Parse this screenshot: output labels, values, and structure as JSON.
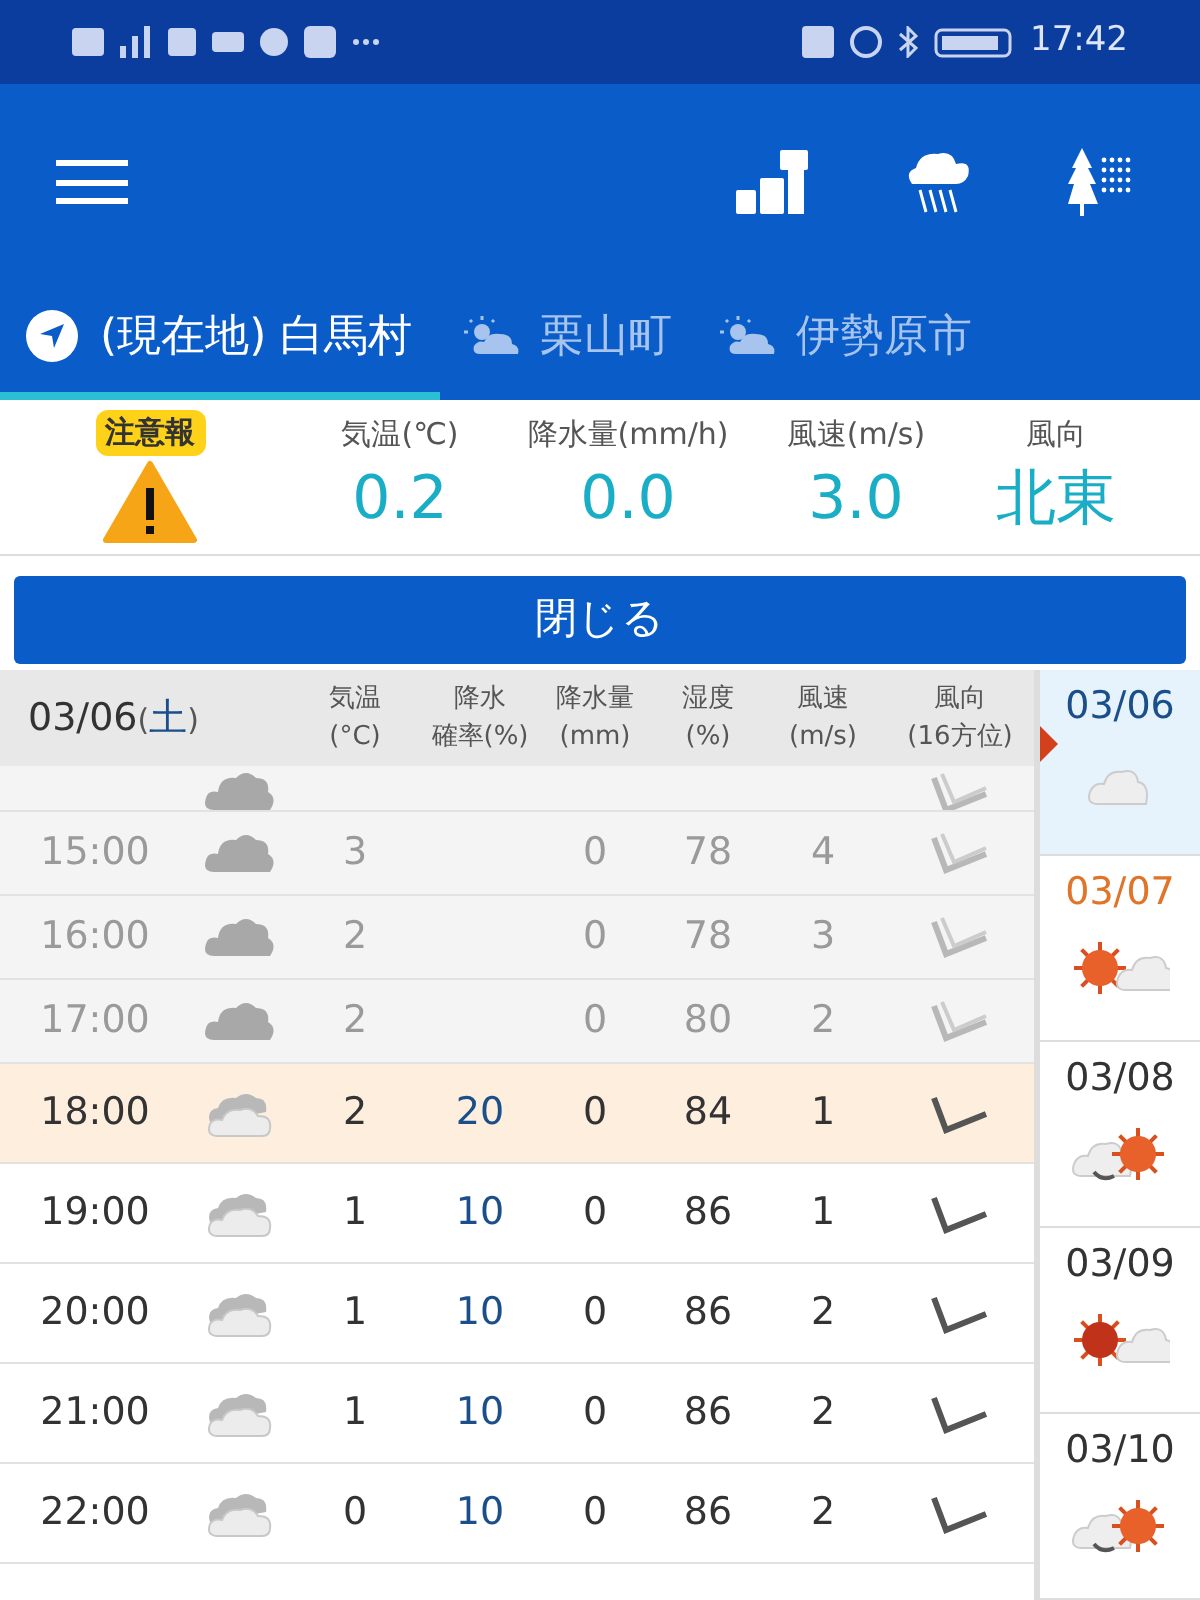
{
  "status_bar": {
    "time": "17:42"
  },
  "tabs": [
    {
      "label": "(現在地) 白馬村",
      "kind": "location",
      "selected": true
    },
    {
      "label": "栗山町",
      "kind": "weather",
      "selected": false
    },
    {
      "label": "伊勢原市",
      "kind": "weather",
      "selected": false
    }
  ],
  "summary": {
    "alert": "注意報",
    "stats": [
      {
        "label": "気温(℃)",
        "value": "0.2"
      },
      {
        "label": "降水量(mm/h)",
        "value": "0.0"
      },
      {
        "label": "風速(m/s)",
        "value": "3.0"
      },
      {
        "label": "風向",
        "value": "北東"
      }
    ]
  },
  "close_button": "閉じる",
  "table": {
    "date_parts": [
      {
        "text": "03/06",
        "kind": "date"
      },
      {
        "text": "(",
        "kind": "paren"
      },
      {
        "text": "土",
        "kind": "day"
      },
      {
        "text": ")",
        "kind": "paren"
      }
    ],
    "columns": [
      {
        "top": "気温",
        "bottom": "(°C)"
      },
      {
        "top": "降水",
        "bottom": "確率(%)"
      },
      {
        "top": "降水量",
        "bottom": "(mm)"
      },
      {
        "top": "湿度",
        "bottom": "(%)"
      },
      {
        "top": "風速",
        "bottom": "(m/s)"
      },
      {
        "top": "風向",
        "bottom": "(16方位)"
      }
    ],
    "rows": [
      {
        "kind": "cut",
        "past": true,
        "selected": false
      },
      {
        "time": "15:00",
        "temp": "3",
        "precip": "0",
        "humidity": "78",
        "wind": "4",
        "past": true,
        "selected": false
      },
      {
        "time": "16:00",
        "temp": "2",
        "precip": "0",
        "humidity": "78",
        "wind": "3",
        "past": true,
        "selected": false
      },
      {
        "time": "17:00",
        "temp": "2",
        "precip": "0",
        "humidity": "80",
        "wind": "2",
        "past": true,
        "selected": false
      },
      {
        "time": "18:00",
        "temp": "2",
        "pop": "20",
        "precip": "0",
        "humidity": "84",
        "wind": "1",
        "past": false,
        "selected": true
      },
      {
        "time": "19:00",
        "temp": "1",
        "pop": "10",
        "precip": "0",
        "humidity": "86",
        "wind": "1",
        "past": false,
        "selected": false
      },
      {
        "time": "20:00",
        "temp": "1",
        "pop": "10",
        "precip": "0",
        "humidity": "86",
        "wind": "2",
        "past": false,
        "selected": false
      },
      {
        "time": "21:00",
        "temp": "1",
        "pop": "10",
        "precip": "0",
        "humidity": "86",
        "wind": "2",
        "past": false,
        "selected": false
      },
      {
        "time": "22:00",
        "temp": "0",
        "pop": "10",
        "precip": "0",
        "humidity": "86",
        "wind": "2",
        "past": false,
        "selected": false
      }
    ]
  },
  "days": [
    {
      "date": "03/06",
      "color": "#1a4f8a",
      "kind": "cloudy",
      "selected": true
    },
    {
      "date": "03/07",
      "color": "#e0752a",
      "kind": "sun_cloud",
      "selected": false
    },
    {
      "date": "03/08",
      "color": "#333333",
      "kind": "cloud_to_sun",
      "selected": false
    },
    {
      "date": "03/09",
      "color": "#333333",
      "kind": "sun_cloud",
      "selected": false
    },
    {
      "date": "03/10",
      "color": "#333333",
      "kind": "cloud_to_sun",
      "selected": false
    }
  ]
}
